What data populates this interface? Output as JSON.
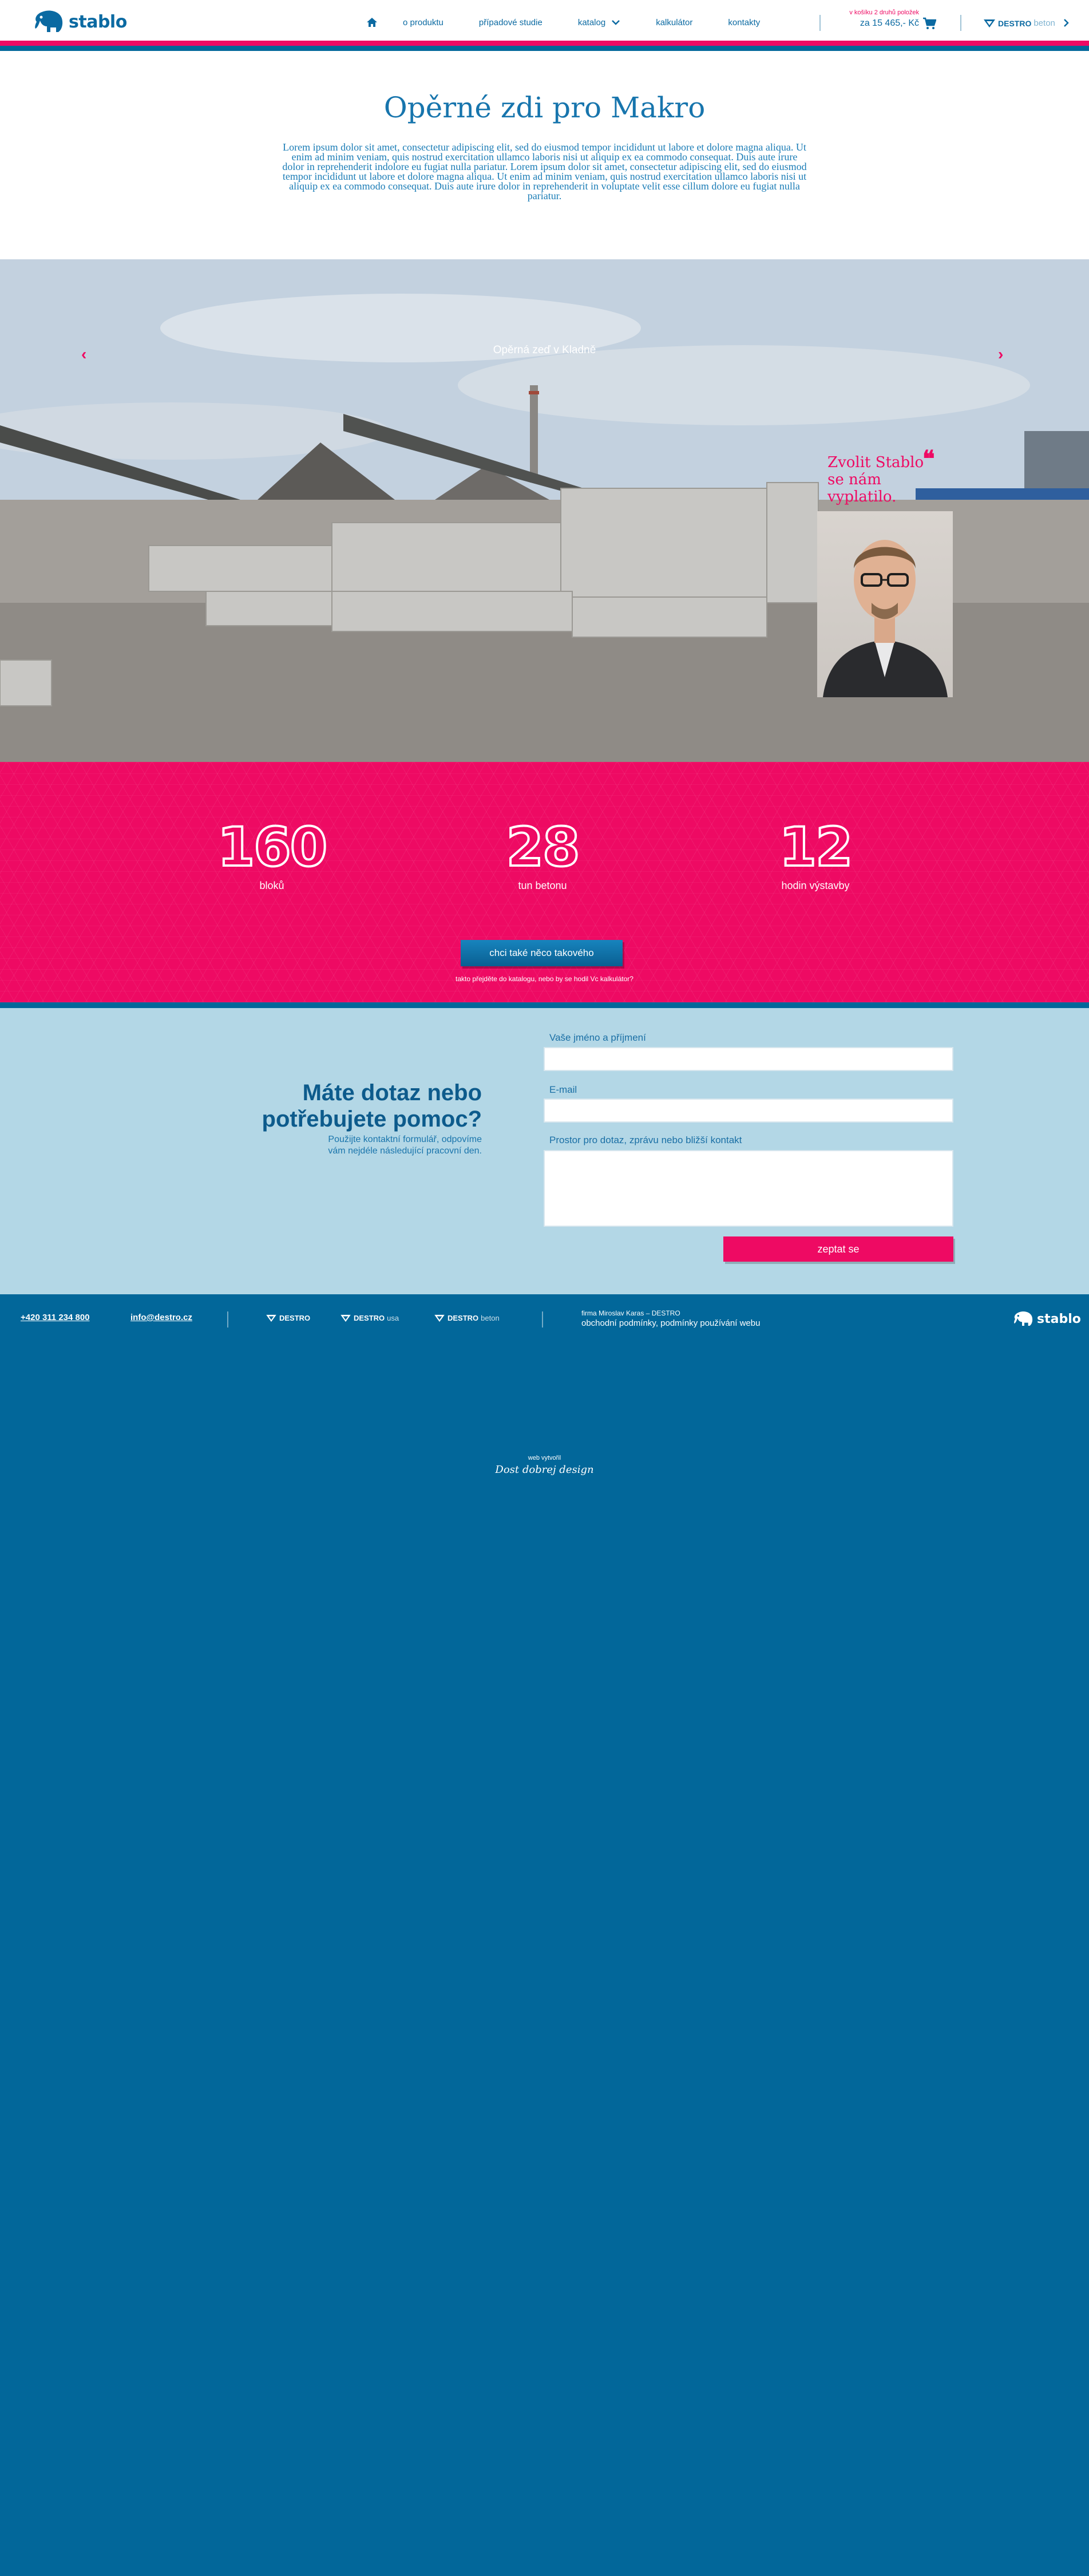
{
  "header": {
    "logo": "stablo",
    "nav": [
      "o produktu",
      "případové studie",
      "katalog",
      "kalkulátor",
      "kontakty"
    ],
    "cart_note": "v košíku 2 druhů položek",
    "cart_price": "za 15 465,- Kč",
    "destro_brand": "DESTRO",
    "destro_sub": "beton"
  },
  "intro": {
    "title": "Opěrné zdi pro Makro",
    "text": "Lorem ipsum dolor sit amet, consectetur adipiscing elit, sed do eiusmod tempor incididunt ut labore et dolore magna aliqua. Ut enim ad minim veniam, quis nostrud exercitation ullamco laboris nisi ut aliquip ex ea commodo consequat. Duis aute irure dolor in reprehenderit indolore eu fugiat nulla pariatur. Lorem ipsum dolor sit amet, consectetur adipiscing elit, sed do eiusmod tempor incididunt ut labore et dolore magna aliqua. Ut enim ad minim veniam, quis nostrud exercitation ullamco laboris nisi ut aliquip ex ea commodo consequat. Duis aute irure dolor in reprehenderit in voluptate velit esse cillum dolore eu fugiat nulla pariatur."
  },
  "hero": {
    "caption": "Opěrná zeď v Kladně",
    "quote": "Zvolit Stablo se nám vyplatilo."
  },
  "stats": [
    {
      "value": "160",
      "label": "bloků"
    },
    {
      "value": "28",
      "label": "tun betonu"
    },
    {
      "value": "12",
      "label": "hodin výstavby"
    }
  ],
  "cta": {
    "button": "chci také něco takového",
    "sub_before": "takto přejděte do ",
    "sub_link1": "katalogu",
    "sub_middle": ", nebo by se hodil Vc ",
    "sub_link2": "kalkulátor",
    "sub_after": "?"
  },
  "contact": {
    "heading_line1": "Máte dotaz nebo",
    "heading_line2": "potřebujete pomoc?",
    "help_line1": "Použijte kontaktní formulář, odpovíme",
    "help_line2": "vám nejdéle následující pracovní den.",
    "name_label": "Vaše jméno a příjmení",
    "email_label": "E-mail",
    "message_label": "Prostor pro dotaz, zprávu nebo bližší kontakt",
    "submit": "zeptat se"
  },
  "footer": {
    "phone": "+420 311 234 800",
    "email": "info@destro.cz",
    "brand1": "DESTRO",
    "brand2_a": "DESTRO",
    "brand2_b": "usa",
    "brand3_a": "DESTRO",
    "brand3_b": "beton",
    "firma": "firma Miroslav Karas – DESTRO",
    "link1": "obchodní podmínky",
    "link2": "podmínky používání webu",
    "logo": "stablo",
    "made_by": "web vytvořil",
    "studio": "Dost dobrej design"
  },
  "colors": {
    "primary": "#0b6aa2",
    "accent": "#ee0a63",
    "footer": "#02679a",
    "contact_bg": "#b3d7e6"
  }
}
